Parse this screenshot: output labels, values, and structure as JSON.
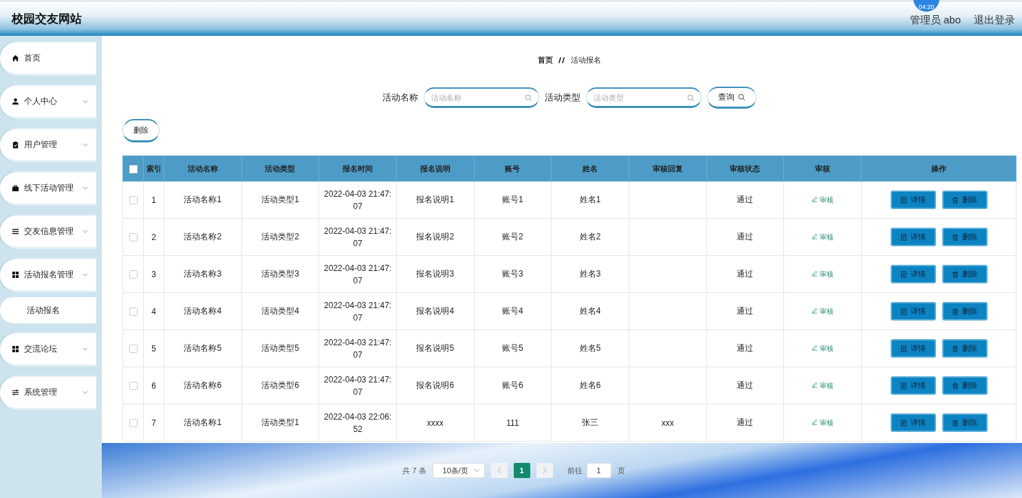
{
  "header": {
    "title": "校园交友网站",
    "timer": "04:20",
    "user": "管理员 abo",
    "logout": "退出登录"
  },
  "sidebar": {
    "items": [
      {
        "kind": "link",
        "label": "首页"
      },
      {
        "kind": "menu",
        "label": "个人中心"
      },
      {
        "kind": "menu",
        "label": "用户管理"
      },
      {
        "kind": "menu",
        "label": "线下活动管理"
      },
      {
        "kind": "menu",
        "label": "交友信息管理"
      },
      {
        "kind": "menu",
        "label": "活动报名管理",
        "children": [
          {
            "label": "活动报名"
          }
        ]
      },
      {
        "kind": "menu",
        "label": "交流论坛"
      },
      {
        "kind": "menu",
        "label": "系统管理"
      }
    ]
  },
  "breadcrumb": [
    "首页",
    "活动报名"
  ],
  "search": {
    "fields": [
      {
        "label": "活动名称",
        "placeholder": "活动名称"
      },
      {
        "label": "活动类型",
        "placeholder": "活动类型"
      }
    ],
    "button": "查询"
  },
  "delete_button": "删除",
  "table": {
    "select_all_checked": false,
    "columns": [
      "索引",
      "活动名称",
      "活动类型",
      "报名时间",
      "报名说明",
      "账号",
      "姓名",
      "审核回复",
      "审核状态",
      "审核",
      "操作"
    ],
    "rows": [
      {
        "checked": false,
        "cells": [
          "1",
          "活动名称1",
          "活动类型1",
          "2022-04-03 21:47:07",
          "报名说明1",
          "账号1",
          "姓名1",
          "",
          "通过"
        ],
        "review": "审核",
        "actions": [
          "详情",
          "删除"
        ]
      },
      {
        "checked": false,
        "cells": [
          "2",
          "活动名称2",
          "活动类型2",
          "2022-04-03 21:47:07",
          "报名说明2",
          "账号2",
          "姓名2",
          "",
          "通过"
        ],
        "review": "审核",
        "actions": [
          "详情",
          "删除"
        ]
      },
      {
        "checked": false,
        "cells": [
          "3",
          "活动名称3",
          "活动类型3",
          "2022-04-03 21:47:07",
          "报名说明3",
          "账号3",
          "姓名3",
          "",
          "通过"
        ],
        "review": "审核",
        "actions": [
          "详情",
          "删除"
        ]
      },
      {
        "checked": false,
        "cells": [
          "4",
          "活动名称4",
          "活动类型4",
          "2022-04-03 21:47:07",
          "报名说明4",
          "账号4",
          "姓名4",
          "",
          "通过"
        ],
        "review": "审核",
        "actions": [
          "详情",
          "删除"
        ]
      },
      {
        "checked": false,
        "cells": [
          "5",
          "活动名称5",
          "活动类型5",
          "2022-04-03 21:47:07",
          "报名说明5",
          "账号5",
          "姓名5",
          "",
          "通过"
        ],
        "review": "审核",
        "actions": [
          "详情",
          "删除"
        ]
      },
      {
        "checked": false,
        "cells": [
          "6",
          "活动名称6",
          "活动类型6",
          "2022-04-03 21:47:07",
          "报名说明6",
          "账号6",
          "姓名6",
          "",
          "通过"
        ],
        "review": "审核",
        "actions": [
          "详情",
          "删除"
        ]
      },
      {
        "checked": false,
        "cells": [
          "7",
          "活动名称1",
          "活动类型1",
          "2022-04-03 22:06:52",
          "xxxx",
          "111",
          "张三",
          "xxx",
          "通过"
        ],
        "review": "审核",
        "actions": [
          "详情",
          "删除"
        ]
      }
    ]
  },
  "pagination": {
    "total": "共 7 条",
    "page_size": "10条/页",
    "pages": [
      {
        "label": "1",
        "selected": true
      }
    ],
    "goto_label": "前往",
    "goto_value": "1",
    "goto_suffix": "页"
  }
}
